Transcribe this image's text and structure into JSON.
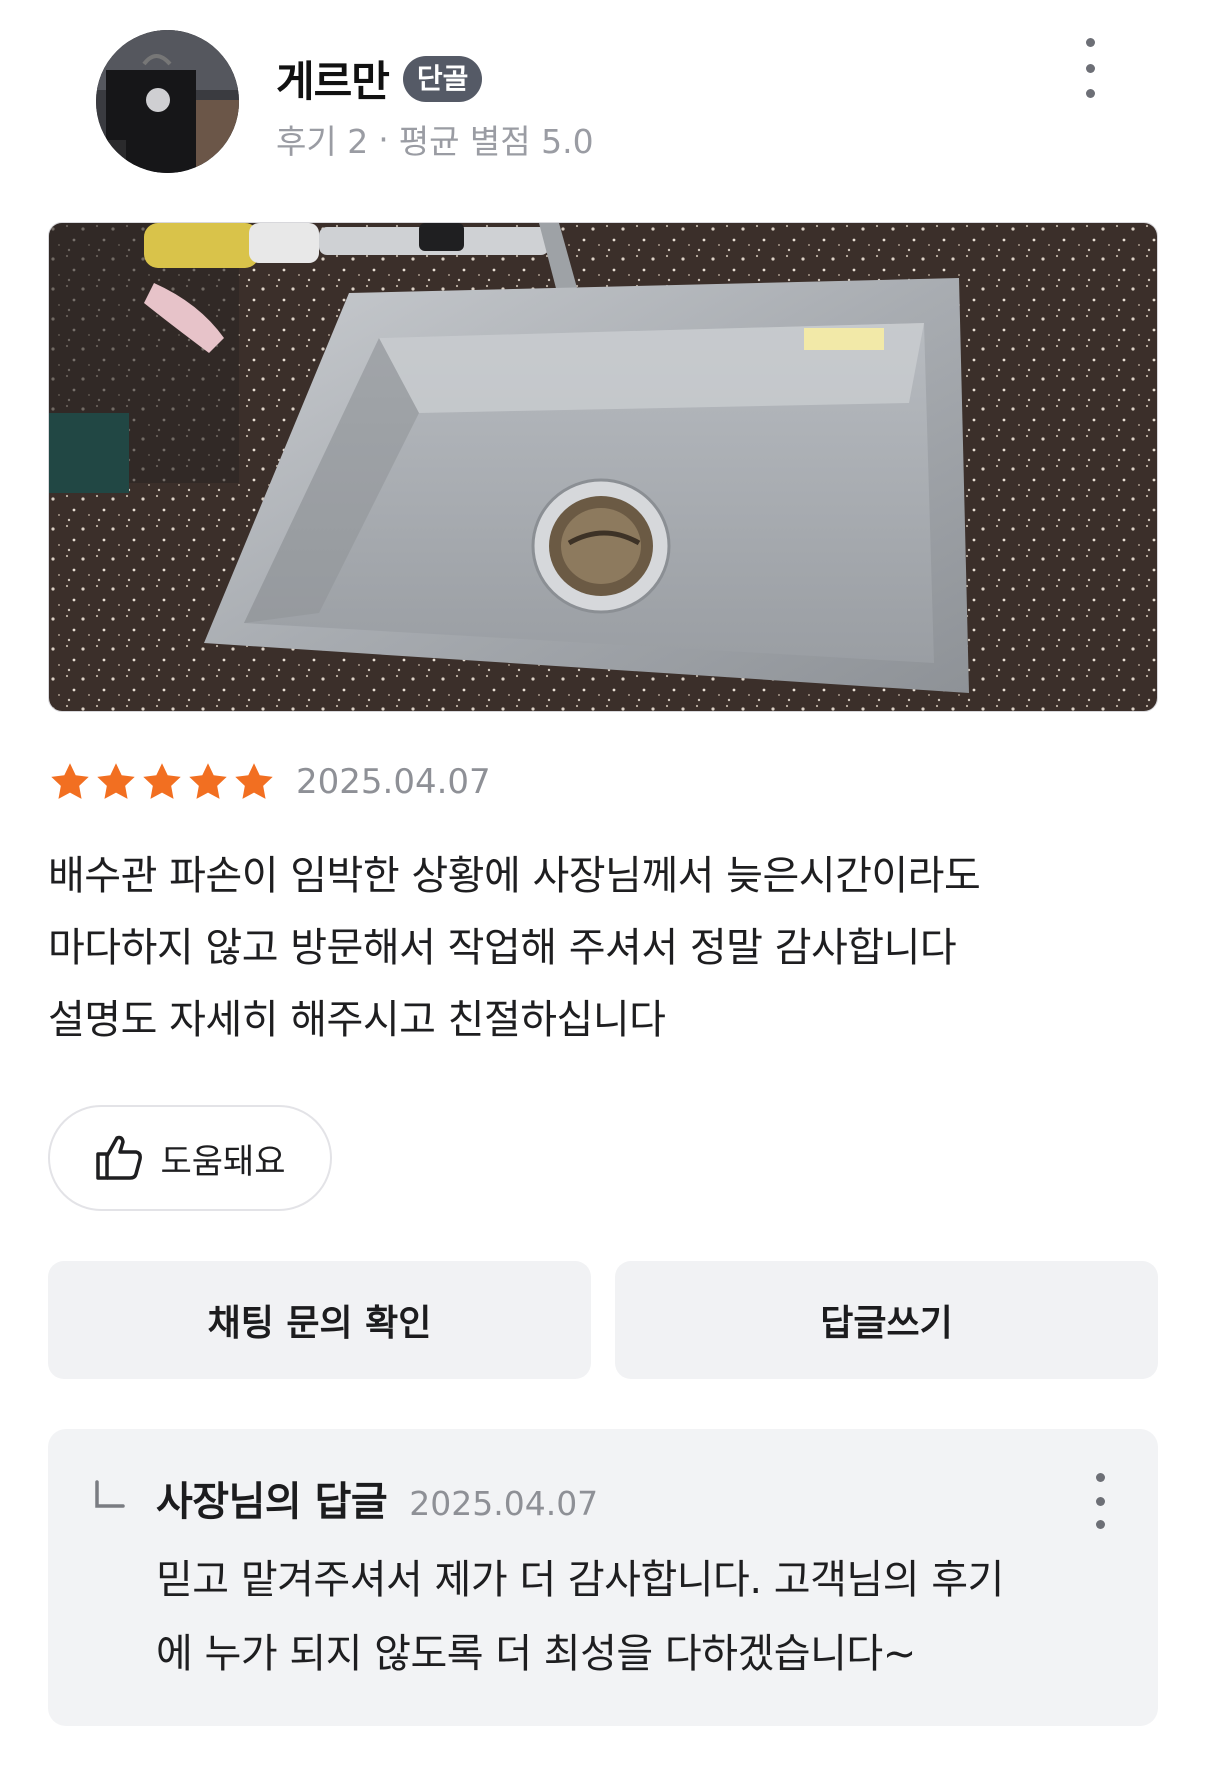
{
  "reviewer": {
    "name": "게르만",
    "badge": "단골",
    "review_count_label": "후기 2",
    "separator": "·",
    "avg_rating_label": "평균 별점 5.0"
  },
  "review": {
    "rating": 5,
    "max_rating": 5,
    "date": "2025.04.07",
    "text_lines": [
      "배수관 파손이 임박한 상황에 사장님께서 늦은시간이라도",
      "마다하지 않고 방문해서 작업해 주셔서 정말 감사합니다",
      "설명도 자세히 해주시고 친절하십니다"
    ],
    "helpful_label": "도움돼요"
  },
  "actions": {
    "chat_inquiry_label": "채팅 문의 확인",
    "write_reply_label": "답글쓰기"
  },
  "owner_reply": {
    "author": "사장님의 답글",
    "date": "2025.04.07",
    "text_lines": [
      "믿고 맡겨주셔서 제가 더 감사합니다. 고객님의 후기",
      "에 누가 되지 않도록 더 최성을 다하겠습니다~"
    ]
  },
  "colors": {
    "star": "#f26f21",
    "badge_bg": "#555a66",
    "button_bg": "#f1f2f4",
    "reply_bg": "#f2f3f5",
    "muted_text": "#8e9096"
  },
  "icons": {
    "more": "more-vertical-icon",
    "star": "star-icon",
    "helpful": "thumbs-up-icon",
    "reply": "reply-arrow-icon"
  }
}
